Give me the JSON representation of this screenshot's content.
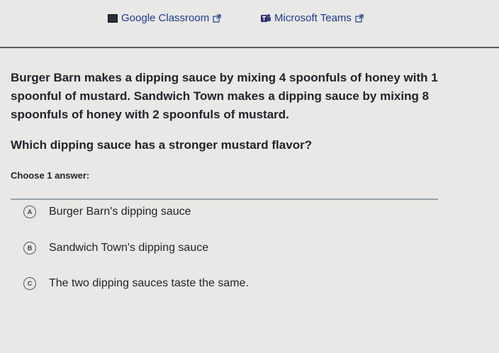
{
  "share": {
    "google_classroom_label": "Google Classroom",
    "microsoft_teams_label": "Microsoft Teams"
  },
  "question": {
    "text": "Burger Barn makes a dipping sauce by mixing 4 spoonfuls of honey with 1 spoonful of mustard. Sandwich Town makes a dipping sauce by mixing 8 spoonfuls of honey with 2 spoonfuls of mustard.",
    "prompt": "Which dipping sauce has a stronger mustard flavor?",
    "choose_label": "Choose 1 answer:"
  },
  "choices": [
    {
      "letter": "A",
      "text": "Burger Barn's dipping sauce"
    },
    {
      "letter": "B",
      "text": "Sandwich Town's dipping sauce"
    },
    {
      "letter": "C",
      "text": "The two dipping sauces taste the same."
    }
  ],
  "colors": {
    "background": "#e8e8e6",
    "link": "#1b3b8a",
    "text": "#21242c"
  },
  "icons": {
    "classroom": "google-classroom-icon",
    "teams": "microsoft-teams-icon",
    "external": "external-link-icon"
  }
}
